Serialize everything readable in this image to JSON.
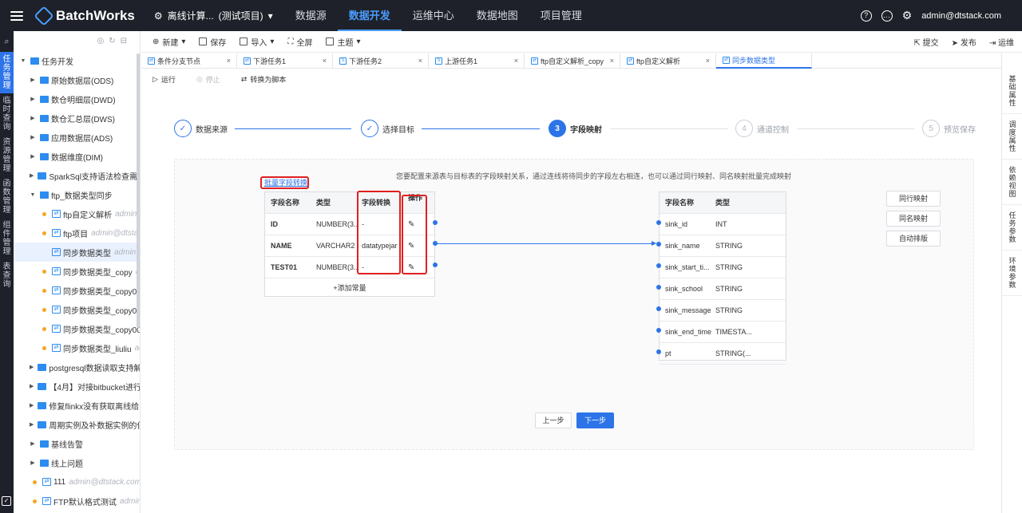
{
  "header": {
    "logo": "BatchWorks",
    "project_icon": "⚙",
    "project_name": "离线计算...",
    "project_tag": "(测试项目)",
    "nav": [
      "数据源",
      "数据开发",
      "运维中心",
      "数据地图",
      "项目管理"
    ],
    "active_nav": "数据开发",
    "user": "admin@dtstack.com"
  },
  "left_rail": [
    "任务管理",
    "临时查询",
    "资源管理",
    "函数管理",
    "组件管理",
    "表查询"
  ],
  "tree": {
    "root": "任务开发",
    "items": [
      {
        "label": "原始数据层(ODS)"
      },
      {
        "label": "数仓明细层(DWD)"
      },
      {
        "label": "数仓汇总层(DWS)"
      },
      {
        "label": "应用数据层(ADS)"
      },
      {
        "label": "数据维度(DIM)"
      },
      {
        "label": "SparkSql支持语法检查需求"
      },
      {
        "label": "ftp_数据类型同步"
      }
    ],
    "children": [
      {
        "label": "ftp自定义解析",
        "owner": "admin@..."
      },
      {
        "label": "ftp项目",
        "owner": "admin@dtstac..."
      },
      {
        "label": "同步数据类型",
        "owner": "admin@..."
      },
      {
        "label": "同步数据类型_copy",
        "owner": "ad..."
      },
      {
        "label": "同步数据类型_copy00",
        "owner": "..."
      },
      {
        "label": "同步数据类型_copy00...",
        "owner": ""
      },
      {
        "label": "同步数据类型_copy00...",
        "owner": ""
      },
      {
        "label": "同步数据类型_liuliu",
        "owner": "ad..."
      }
    ],
    "more": [
      {
        "label": "postgresql数据读取支持解..."
      },
      {
        "label": "【4月】对接bitbucket进行..."
      },
      {
        "label": "修复flinkx没有获取离线给..."
      },
      {
        "label": "周期实例及补数据实例的保..."
      },
      {
        "label": "基线告警"
      },
      {
        "label": "线上问题"
      }
    ],
    "tail": [
      {
        "label": "111",
        "owner": "admin@dtstack.com..."
      },
      {
        "label": "FTP默认格式测试",
        "owner": "admin..."
      }
    ]
  },
  "toolbar": {
    "new": "新建",
    "save": "保存",
    "import": "导入",
    "full": "全屏",
    "theme": "主题",
    "submit": "提交",
    "publish": "发布",
    "ops": "运维"
  },
  "tabs": [
    "条件分支节点",
    "下游任务1",
    "下游任务2",
    "上游任务1",
    "ftp自定义解析_copy",
    "ftp自定义解析",
    "同步数据类型"
  ],
  "subbar": {
    "run": "运行",
    "stop": "停止",
    "convert": "转换为脚本"
  },
  "right_rail": [
    "基础属性",
    "调度属性",
    "依赖视图",
    "任务参数",
    "环境参数"
  ],
  "steps": [
    {
      "num": "1",
      "label": "数据来源",
      "state": "done"
    },
    {
      "num": "2",
      "label": "选择目标",
      "state": "done"
    },
    {
      "num": "3",
      "label": "字段映射",
      "state": "current"
    },
    {
      "num": "4",
      "label": "通道控制",
      "state": "todo"
    },
    {
      "num": "5",
      "label": "预览保存",
      "state": "todo"
    }
  ],
  "mapping": {
    "hint": "您要配置来源表与目标表的字段映射关系，通过连线将待同步的字段左右相连，也可以通过同行映射、同名映射批量完成映射",
    "batch_convert": "批量字段转换",
    "source_headers": [
      "字段名称",
      "类型",
      "字段转换",
      "操作"
    ],
    "source_rows": [
      {
        "name": "ID",
        "type": "NUMBER(3...",
        "convert": "-"
      },
      {
        "name": "NAME",
        "type": "VARCHAR2",
        "convert": "datatypejar"
      },
      {
        "name": "TEST01",
        "type": "NUMBER(3...",
        "convert": "-"
      }
    ],
    "add_const": "+添加常量",
    "target_headers": [
      "字段名称",
      "类型"
    ],
    "target_rows": [
      {
        "name": "sink_id",
        "type": "INT"
      },
      {
        "name": "sink_name",
        "type": "STRING"
      },
      {
        "name": "sink_start_ti...",
        "type": "STRING"
      },
      {
        "name": "sink_school",
        "type": "STRING"
      },
      {
        "name": "sink_message",
        "type": "STRING"
      },
      {
        "name": "sink_end_time",
        "type": "TIMESTA..."
      },
      {
        "name": "pt",
        "type": "STRING(..."
      }
    ],
    "buttons": {
      "row_map": "同行映射",
      "name_map": "同名映射",
      "auto_layout": "自动排版"
    },
    "prev": "上一步",
    "next": "下一步"
  }
}
